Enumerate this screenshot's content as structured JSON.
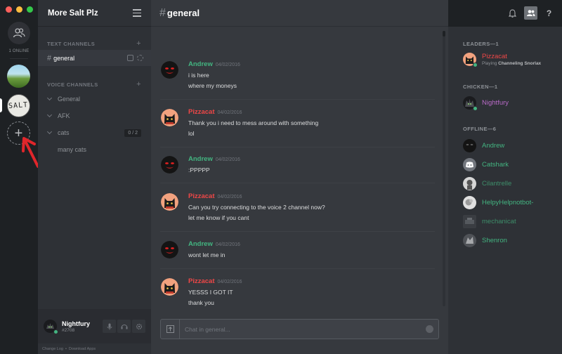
{
  "servers": {
    "online_label": "1 ONLINE",
    "salt_label": "SALT",
    "add_label": "+"
  },
  "guild": {
    "name": "More Salt Plz"
  },
  "channels": {
    "text_header": "TEXT CHANNELS",
    "voice_header": "VOICE CHANNELS",
    "plus": "+",
    "hash": "#",
    "text": [
      {
        "name": "general",
        "active": true
      }
    ],
    "voice": [
      {
        "name": "General"
      },
      {
        "name": "AFK"
      },
      {
        "name": "cats",
        "count": "0 / 2"
      },
      {
        "name": "many cats"
      }
    ]
  },
  "user": {
    "name": "Nightfury",
    "tag": "#2708"
  },
  "footer": {
    "change_log": "Change Log",
    "separator": "•",
    "download_apps": "Download Apps"
  },
  "chat": {
    "hash": "#",
    "channel": "general",
    "placeholder": "Chat in general...",
    "messages": [
      {
        "author": "Andrew",
        "time": "04/02/2016",
        "lines": [
          "i is here",
          "where my moneys"
        ]
      },
      {
        "author": "Pizzacat",
        "time": "04/02/2016",
        "lines": [
          "Thank you i need to mess around with something",
          "lol"
        ]
      },
      {
        "author": "Andrew",
        "time": "04/02/2016",
        "lines": [
          ":PPPPP"
        ]
      },
      {
        "author": "Pizzacat",
        "time": "04/02/2016",
        "lines": [
          "Can you try connecting to the voice 2 channel now?",
          "let me know if you cant"
        ]
      },
      {
        "author": "Andrew",
        "time": "04/02/2016",
        "lines": [
          "wont let me in"
        ]
      },
      {
        "author": "Pizzacat",
        "time": "04/02/2016",
        "lines": [
          "YESSS I GOT IT",
          "thank you"
        ]
      }
    ]
  },
  "toolbar": {
    "help": "?"
  },
  "members": {
    "leaders_header": "LEADERS—1",
    "chicken_header": "CHICKEN—1",
    "offline_header": "OFFLINE—6",
    "leaders": [
      {
        "name": "Pizzacat",
        "playing_prefix": "Playing",
        "game": "Channeling Snorlax"
      }
    ],
    "chicken": [
      {
        "name": "Nightfury"
      }
    ],
    "offline": [
      {
        "name": "Andrew"
      },
      {
        "name": "Catshark"
      },
      {
        "name": "Cilantrelle"
      },
      {
        "name": "HelpyHelpnotbot-"
      },
      {
        "name": "mechanicat"
      },
      {
        "name": "Shenron"
      }
    ]
  },
  "colors": {
    "andrew": "#43b581",
    "pizzacat": "#f04747",
    "nightfury": "#b86ac7",
    "offline_name": "#43b581"
  }
}
